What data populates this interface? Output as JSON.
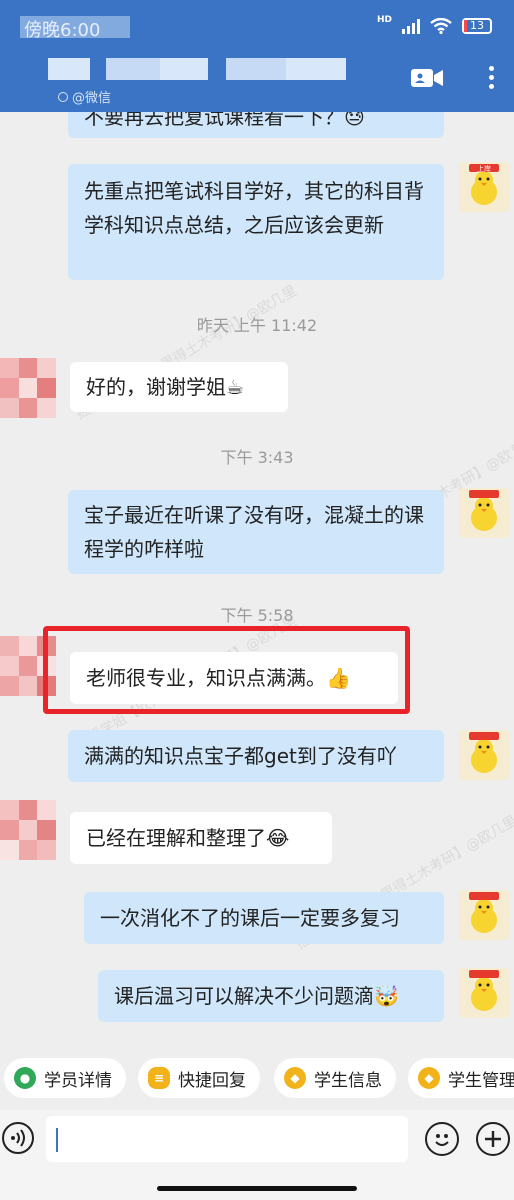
{
  "status_bar": {
    "time": "傍晚6:00",
    "hd": "HD",
    "battery": 13,
    "battery_label": "13"
  },
  "header": {
    "contact_name": "",
    "subtitle": "@微信"
  },
  "messages": [
    {
      "dir": "out",
      "text": "不要再去把复试课程看一下？",
      "emoji": "😓"
    },
    {
      "dir": "out",
      "text": "先重点把笔试科目学好，其它的科目背学科知识点总结，之后应该会更新"
    },
    {
      "dir": "time",
      "text": "昨天 上午 11:42"
    },
    {
      "dir": "in",
      "text": "好的，谢谢学姐",
      "emoji": "☕"
    },
    {
      "dir": "time",
      "text": "下午 3:43"
    },
    {
      "dir": "out",
      "text": "宝子最近在听课了没有呀，混凝土的课程学的咋样啦"
    },
    {
      "dir": "time",
      "text": "下午 5:58"
    },
    {
      "dir": "in",
      "text": "老师很专业，知识点满满。",
      "emoji": "👍",
      "highlighted": true
    },
    {
      "dir": "out",
      "text": "满满的知识点宝子都get到了没有吖"
    },
    {
      "dir": "in",
      "text": "已经在理解和整理了",
      "emoji": "😂"
    },
    {
      "dir": "out",
      "text": "一次消化不了的课后一定要多复习"
    },
    {
      "dir": "out",
      "text": "课后温习可以解决不少问题滴",
      "emoji": "🤯"
    }
  ],
  "self_avatar_text": "上岸",
  "watermark": "摇摇学姐【欧几里得土木考研】@欧几里",
  "quick_actions": [
    {
      "label": "学员详情",
      "icon": "person-icon",
      "color": "#2fa85a"
    },
    {
      "label": "快捷回复",
      "icon": "quick-reply-icon",
      "color": "#f2b21a"
    },
    {
      "label": "学生信息",
      "icon": "brand-logo-icon",
      "color": "#f2b21a"
    },
    {
      "label": "学生管理",
      "icon": "brand-logo-icon",
      "color": "#f2b21a"
    }
  ],
  "input": {
    "value": "",
    "placeholder": ""
  },
  "colors": {
    "header": "#3b74c4",
    "bubble_out": "#cfe6fb",
    "bubble_in": "#ffffff",
    "highlight": "#e8232a"
  }
}
